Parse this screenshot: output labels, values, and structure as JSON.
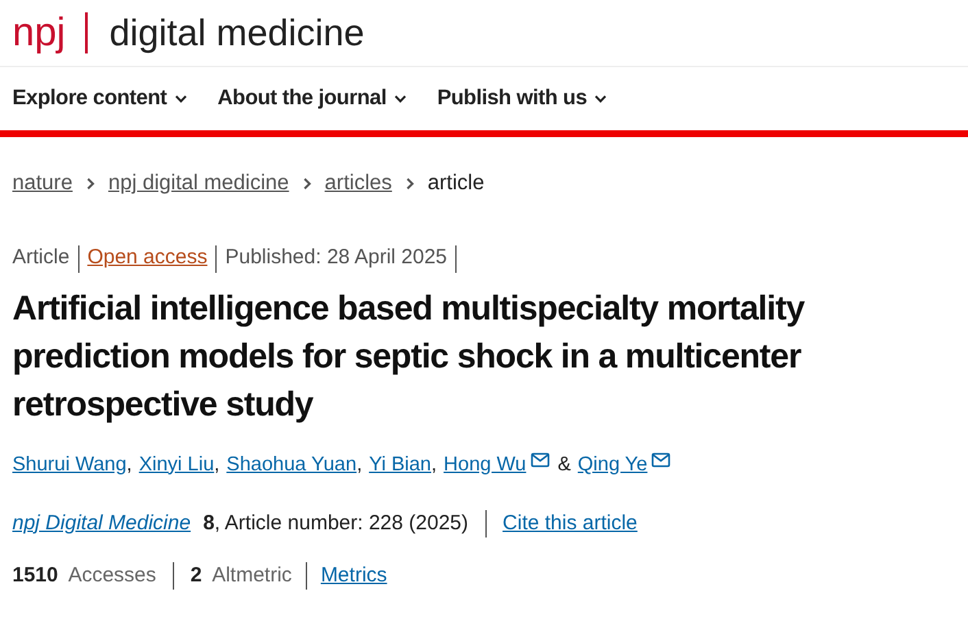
{
  "logo": {
    "mark": "npj",
    "title": "digital medicine"
  },
  "nav": [
    {
      "label": "Explore content"
    },
    {
      "label": "About the journal"
    },
    {
      "label": "Publish with us"
    }
  ],
  "breadcrumbs": [
    {
      "label": "nature",
      "kind": "link"
    },
    {
      "label": "npj digital medicine",
      "kind": "link"
    },
    {
      "label": "articles",
      "kind": "link"
    },
    {
      "label": "article",
      "kind": "current"
    }
  ],
  "meta": [
    {
      "label": "Article",
      "kind": "text"
    },
    {
      "label": "Open access",
      "kind": "link"
    },
    {
      "label": "Published: 28 April 2025",
      "kind": "text"
    }
  ],
  "title": "Artificial intelligence based multispecialty mortality prediction models for septic shock in a multicenter retrospective study",
  "authors": [
    {
      "name": "Shurui Wang",
      "kind": "plain",
      "sep": ","
    },
    {
      "name": "Xinyi Liu",
      "kind": "plain",
      "sep": ","
    },
    {
      "name": "Shaohua Yuan",
      "kind": "plain",
      "sep": ","
    },
    {
      "name": "Yi Bian",
      "kind": "plain",
      "sep": ","
    },
    {
      "name": "Hong Wu",
      "kind": "corresponding",
      "sep": "&"
    },
    {
      "name": "Qing Ye",
      "kind": "corresponding"
    }
  ],
  "citation": {
    "journal": "npj Digital Medicine",
    "volume": "8",
    "details": ", Article number: 228 (2025)",
    "cite": "Cite this article"
  },
  "metrics": [
    {
      "text": "**1510** Accesses"
    },
    {
      "text": "**2** Altmetric"
    }
  ],
  "metrics_link": "Metrics"
}
